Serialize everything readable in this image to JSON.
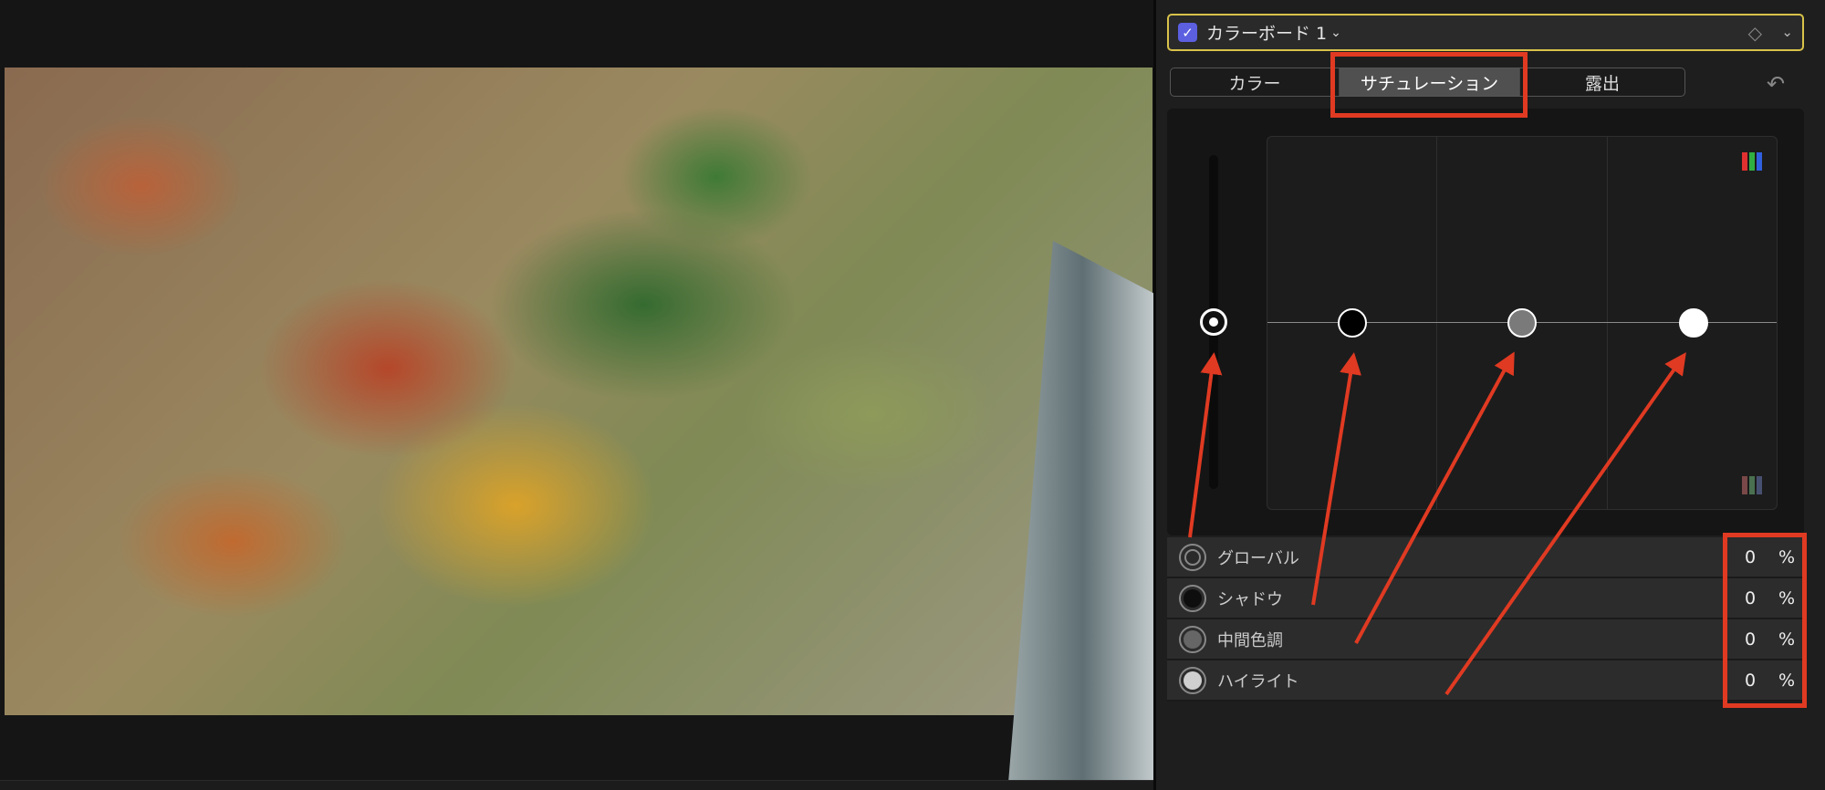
{
  "header": {
    "title": "カラーボード 1",
    "enabled": true
  },
  "tabs": [
    {
      "label": "カラー"
    },
    {
      "label": "サチュレーション",
      "active": true
    },
    {
      "label": "露出"
    }
  ],
  "rows": [
    {
      "label": "グローバル",
      "value": "0",
      "unit": "%",
      "swatch": "#2a2a2a"
    },
    {
      "label": "シャドウ",
      "value": "0",
      "unit": "%",
      "swatch": "#0e0e0e"
    },
    {
      "label": "中間色調",
      "value": "0",
      "unit": "%",
      "swatch": "#666666"
    },
    {
      "label": "ハイライト",
      "value": "0",
      "unit": "%",
      "swatch": "#cfcfcf"
    }
  ],
  "colors": {
    "accent": "#5b5fe0",
    "annotation": "#e03a22",
    "header_border": "#d8c24a"
  }
}
